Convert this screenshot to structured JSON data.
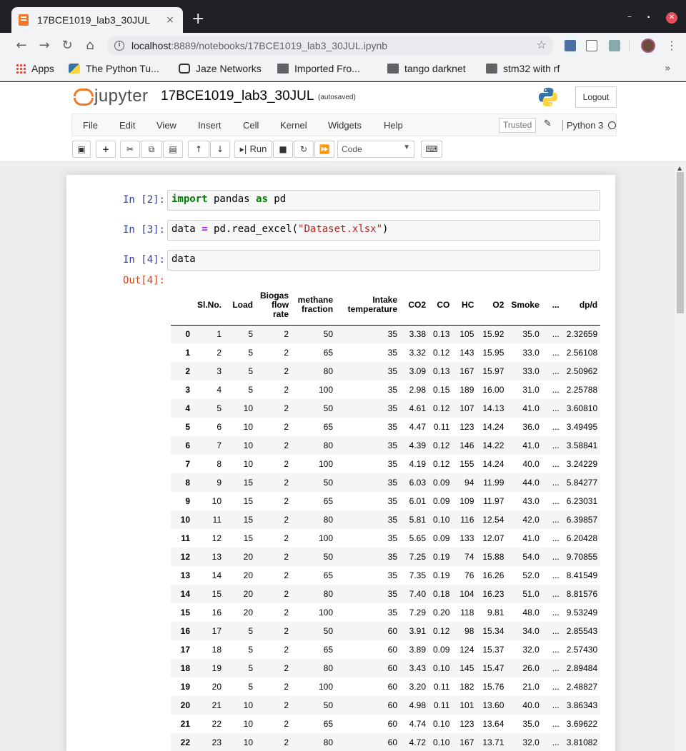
{
  "browser": {
    "tab_title": "17BCE1019_lab3_30JUL",
    "tab_close": "×",
    "new_tab": "+",
    "url_host": "localhost",
    "url_path": ":8889/notebooks/17BCE1019_lab3_30JUL.ipynb",
    "bookmarks": [
      "Apps",
      "The Python Tu...",
      "Jaze Networks",
      "Imported Fro...",
      "tango darknet",
      "stm32 with rf"
    ],
    "bookmarks_more": "»"
  },
  "jupyter": {
    "logo_text": "jupyter",
    "notebook_name": "17BCE1019_lab3_30JUL",
    "autosave": "(autosaved)",
    "logout": "Logout",
    "menu": [
      "File",
      "Edit",
      "View",
      "Insert",
      "Cell",
      "Kernel",
      "Widgets",
      "Help"
    ],
    "trusted": "Trusted",
    "kernel": "Python 3",
    "run_label": "Run",
    "cell_type": "Code"
  },
  "cells": [
    {
      "prompt": "In [2]:"
    },
    {
      "prompt": "In [3]:"
    },
    {
      "prompt": "In [4]:",
      "code": "data"
    }
  ],
  "code": {
    "c2_kw1": "import",
    "c2_mod": " pandas ",
    "c2_kw2": "as",
    "c2_alias": " pd",
    "c3_var": "data ",
    "c3_eq": "=",
    "c3_call": " pd.read_excel(",
    "c3_str": "\"Dataset.xlsx\"",
    "c3_close": ")"
  },
  "output": {
    "prompt": "Out[4]:",
    "columns": [
      "",
      "Sl.No.",
      "Load",
      "Biogas flow rate",
      "methane fraction",
      "Intake temperature",
      "CO2",
      "CO",
      "HC",
      "O2",
      "Smoke",
      "...",
      "dp/d"
    ],
    "rows": [
      [
        "0",
        "1",
        "5",
        "2",
        "50",
        "35",
        "3.38",
        "0.13",
        "105",
        "15.92",
        "35.0",
        "...",
        "2.32659"
      ],
      [
        "1",
        "2",
        "5",
        "2",
        "65",
        "35",
        "3.32",
        "0.12",
        "143",
        "15.95",
        "33.0",
        "...",
        "2.56108"
      ],
      [
        "2",
        "3",
        "5",
        "2",
        "80",
        "35",
        "3.09",
        "0.13",
        "167",
        "15.97",
        "33.0",
        "...",
        "2.50962"
      ],
      [
        "3",
        "4",
        "5",
        "2",
        "100",
        "35",
        "2.98",
        "0.15",
        "189",
        "16.00",
        "31.0",
        "...",
        "2.25788"
      ],
      [
        "4",
        "5",
        "10",
        "2",
        "50",
        "35",
        "4.61",
        "0.12",
        "107",
        "14.13",
        "41.0",
        "...",
        "3.60810"
      ],
      [
        "5",
        "6",
        "10",
        "2",
        "65",
        "35",
        "4.47",
        "0.11",
        "123",
        "14.24",
        "36.0",
        "...",
        "3.49495"
      ],
      [
        "6",
        "7",
        "10",
        "2",
        "80",
        "35",
        "4.39",
        "0.12",
        "146",
        "14.22",
        "41.0",
        "...",
        "3.58841"
      ],
      [
        "7",
        "8",
        "10",
        "2",
        "100",
        "35",
        "4.19",
        "0.12",
        "155",
        "14.24",
        "40.0",
        "...",
        "3.24229"
      ],
      [
        "8",
        "9",
        "15",
        "2",
        "50",
        "35",
        "6.03",
        "0.09",
        "94",
        "11.99",
        "44.0",
        "...",
        "5.84277"
      ],
      [
        "9",
        "10",
        "15",
        "2",
        "65",
        "35",
        "6.01",
        "0.09",
        "109",
        "11.97",
        "43.0",
        "...",
        "6.23031"
      ],
      [
        "10",
        "11",
        "15",
        "2",
        "80",
        "35",
        "5.81",
        "0.10",
        "116",
        "12.54",
        "42.0",
        "...",
        "6.39857"
      ],
      [
        "11",
        "12",
        "15",
        "2",
        "100",
        "35",
        "5.65",
        "0.09",
        "133",
        "12.07",
        "41.0",
        "...",
        "6.20428"
      ],
      [
        "12",
        "13",
        "20",
        "2",
        "50",
        "35",
        "7.25",
        "0.19",
        "74",
        "15.88",
        "54.0",
        "...",
        "9.70855"
      ],
      [
        "13",
        "14",
        "20",
        "2",
        "65",
        "35",
        "7.35",
        "0.19",
        "76",
        "16.26",
        "52.0",
        "...",
        "8.41549"
      ],
      [
        "14",
        "15",
        "20",
        "2",
        "80",
        "35",
        "7.40",
        "0.18",
        "104",
        "16.23",
        "51.0",
        "...",
        "8.81576"
      ],
      [
        "15",
        "16",
        "20",
        "2",
        "100",
        "35",
        "7.29",
        "0.20",
        "118",
        "9.81",
        "48.0",
        "...",
        "9.53249"
      ],
      [
        "16",
        "17",
        "5",
        "2",
        "50",
        "60",
        "3.91",
        "0.12",
        "98",
        "15.34",
        "34.0",
        "...",
        "2.85543"
      ],
      [
        "17",
        "18",
        "5",
        "2",
        "65",
        "60",
        "3.89",
        "0.09",
        "124",
        "15.37",
        "32.0",
        "...",
        "2.57430"
      ],
      [
        "18",
        "19",
        "5",
        "2",
        "80",
        "60",
        "3.43",
        "0.10",
        "145",
        "15.47",
        "26.0",
        "...",
        "2.89484"
      ],
      [
        "19",
        "20",
        "5",
        "2",
        "100",
        "60",
        "3.20",
        "0.11",
        "182",
        "15.76",
        "21.0",
        "...",
        "2.48827"
      ],
      [
        "20",
        "21",
        "10",
        "2",
        "50",
        "60",
        "4.98",
        "0.11",
        "101",
        "13.60",
        "40.0",
        "...",
        "3.86343"
      ],
      [
        "21",
        "22",
        "10",
        "2",
        "65",
        "60",
        "4.74",
        "0.10",
        "123",
        "13.64",
        "35.0",
        "...",
        "3.69622"
      ],
      [
        "22",
        "23",
        "10",
        "2",
        "80",
        "60",
        "4.72",
        "0.10",
        "167",
        "13.71",
        "32.0",
        "...",
        "3.81082"
      ]
    ]
  }
}
